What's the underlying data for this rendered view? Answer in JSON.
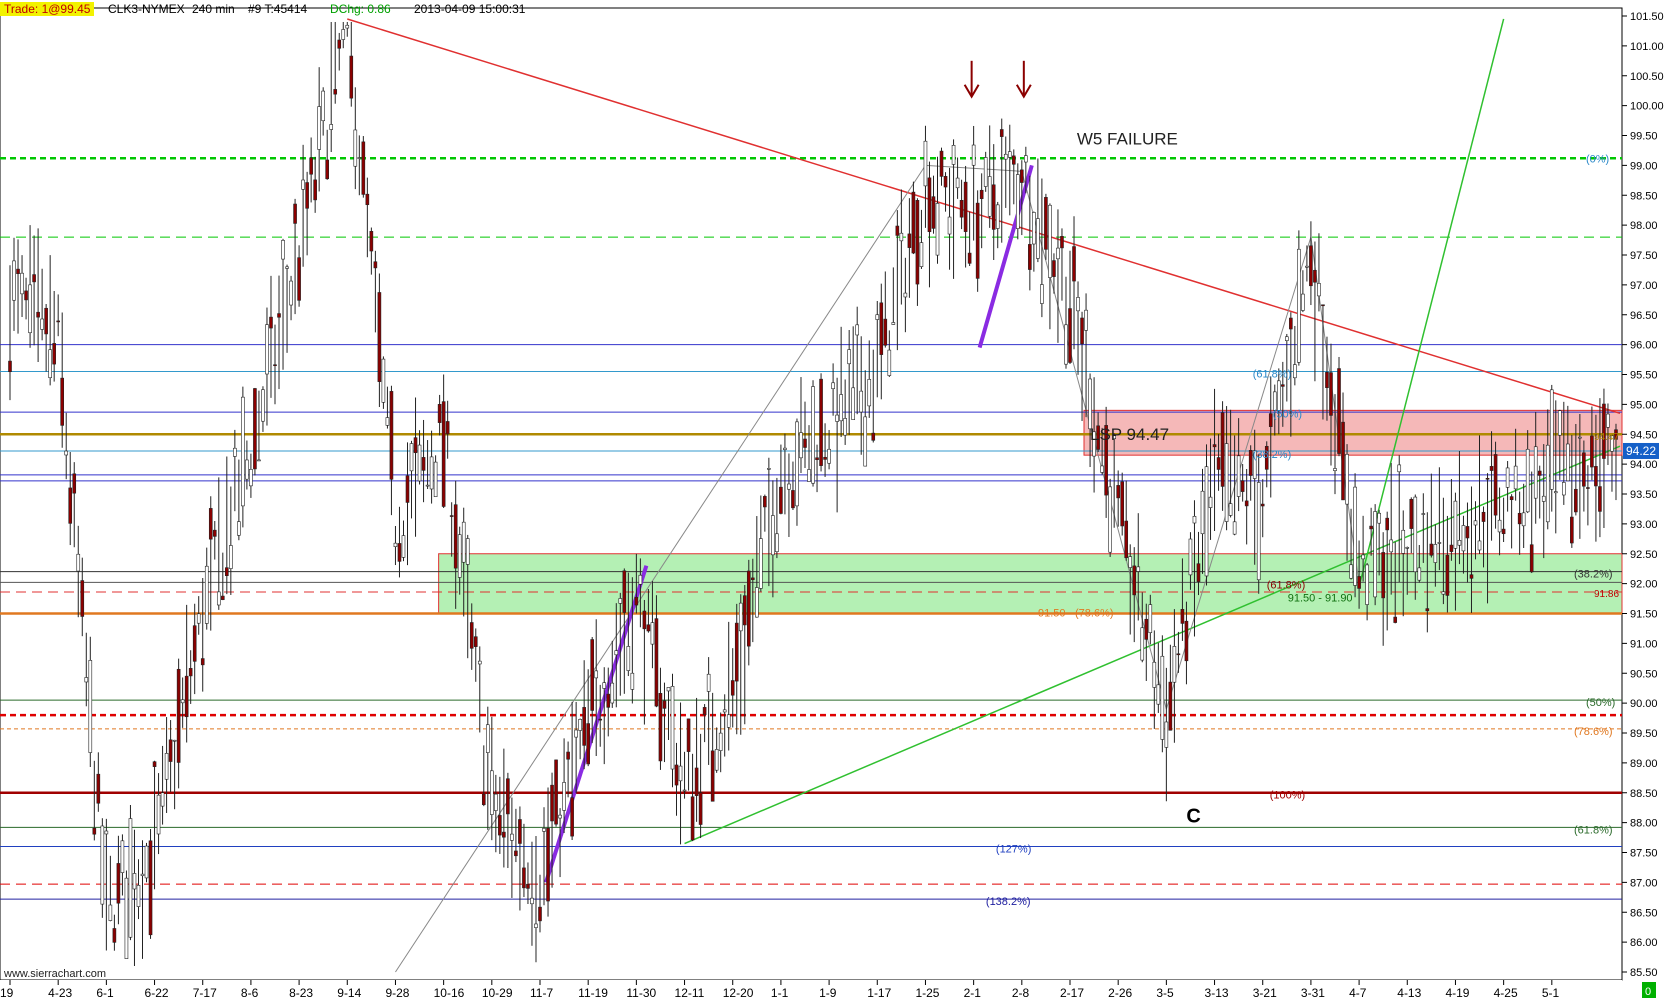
{
  "header": {
    "trade": "Trade: 1@99.45",
    "symbol": "CLK3-NYMEX",
    "interval": "240 min",
    "bar_info": "#9 T:45414",
    "dchg": "DChg: 0.86",
    "datetime": "2013-04-09 15:00:31",
    "trade_bg": "#f2f200",
    "dchg_color": "#00a000"
  },
  "footer": {
    "url": "www.sierrachart.com"
  },
  "chart_data": {
    "type": "candlestick",
    "title": "",
    "price_axis": {
      "min": 85.5,
      "max": 101.5,
      "tick_step": 0.5,
      "current_price": "94.22",
      "bottom_right_label": "0"
    },
    "date_axis": {
      "ticks": [
        "19",
        "4-23",
        "6-1",
        "6-22",
        "7-17",
        "8-6",
        "8-23",
        "9-14",
        "9-28",
        "10-16",
        "10-29",
        "11-7",
        "11-19",
        "11-30",
        "12-11",
        "12-20",
        "1-1",
        "1-9",
        "1-17",
        "1-25",
        "2-1",
        "2-8",
        "2-17",
        "2-26",
        "3-5",
        "3-13",
        "3-21",
        "3-31",
        "4-7",
        "4-13",
        "4-19",
        "4-25",
        "5-1"
      ]
    },
    "annotations": {
      "w5_failure": "W5 FAILURE",
      "lsp": "LSP  94.47",
      "wave_c": "C",
      "zone_label": "91.50 - 91.90",
      "zone_left_value": "91.50",
      "zone_left_fib": "(78.6%)",
      "fib_0": "(0%)",
      "fib_61_8_top": "(61.8%)",
      "fib_50_top": "(50%)",
      "fib_38_2_top": "(38.2%)",
      "fib_38_2_right": "(38.2%)",
      "fib_61_8_mid": "(61.8%)",
      "fib_50_right": "(50%)",
      "fib_78_6_right": "(78.6%)",
      "fib_100": "(100%)",
      "fib_61_8_low": "(61.8%)",
      "fib_127": "(127%)",
      "fib_138_2": "(138.2%)",
      "lsp_axis_label": "94.47",
      "red_dash_label": "91.86"
    },
    "horizontal_levels": [
      {
        "price": 99.12,
        "color": "#00c800",
        "style": "dash-bold"
      },
      {
        "price": 97.8,
        "color": "#00c800",
        "style": "dash"
      },
      {
        "price": 96.0,
        "color": "#3333cc",
        "style": "solid"
      },
      {
        "price": 95.55,
        "color": "#3399cc",
        "style": "solid-thin"
      },
      {
        "price": 94.87,
        "color": "#3333cc",
        "style": "solid-thin"
      },
      {
        "price": 94.5,
        "color": "#b08a00",
        "style": "solid-bold"
      },
      {
        "price": 94.22,
        "color": "#3399cc",
        "style": "solid-thin"
      },
      {
        "price": 93.82,
        "color": "#3333cc",
        "style": "solid"
      },
      {
        "price": 93.72,
        "color": "#3333cc",
        "style": "solid"
      },
      {
        "price": 92.2,
        "color": "#333333",
        "style": "solid-thin"
      },
      {
        "price": 92.02,
        "color": "#555555",
        "style": "solid-thin"
      },
      {
        "price": 91.86,
        "color": "#e03030",
        "style": "dash"
      },
      {
        "price": 91.5,
        "color": "#e07820",
        "style": "solid-bold"
      },
      {
        "price": 90.05,
        "color": "#2a6a2a",
        "style": "solid-thin"
      },
      {
        "price": 89.8,
        "color": "#e00000",
        "style": "dash-bold"
      },
      {
        "price": 89.57,
        "color": "#e07820",
        "style": "dash-fine"
      },
      {
        "price": 88.5,
        "color": "#a00000",
        "style": "solid-bold"
      },
      {
        "price": 87.92,
        "color": "#2a6a2a",
        "style": "solid-thin"
      },
      {
        "price": 87.6,
        "color": "#2040c0",
        "style": "solid"
      },
      {
        "price": 86.97,
        "color": "#e00000",
        "style": "dash"
      },
      {
        "price": 86.72,
        "color": "#2020a0",
        "style": "solid-thin"
      }
    ],
    "zones": [
      {
        "from": 91.5,
        "to": 92.5,
        "fill": "#b4f0b4",
        "border": "#e03030"
      },
      {
        "from": 94.15,
        "to": 94.9,
        "fill": "#f5b8b8",
        "border": "#e03030"
      }
    ],
    "trendlines": [
      {
        "name": "red-downtrend",
        "from_date": "9-14",
        "from_price": 101.45,
        "to_date": "end",
        "to_price": 94.85,
        "color": "#e03030"
      },
      {
        "name": "green-uptrend",
        "from_date": "12-11",
        "from_price": 87.65,
        "to_date": "end",
        "to_price": 94.3,
        "color": "#30c030"
      },
      {
        "name": "green-projection",
        "from_date": "4-7",
        "from_price": 91.95,
        "to_date": "4-25",
        "to_price": 101.45,
        "color": "#30c030"
      }
    ],
    "series": [
      {
        "type": "close-path",
        "points": [
          [
            "19",
            96.8
          ],
          [
            "4-23",
            96.0
          ],
          [
            "6-1",
            86.5
          ],
          [
            "6-22",
            87.5
          ],
          [
            "7-17",
            91.5
          ],
          [
            "8-6",
            94.2
          ],
          [
            "8-23",
            97.5
          ],
          [
            "9-14",
            101.4
          ],
          [
            "9-28",
            93.0
          ],
          [
            "10-16",
            94.5
          ],
          [
            "10-29",
            88.3
          ],
          [
            "11-7",
            87.1
          ],
          [
            "11-19",
            89.6
          ],
          [
            "11-30",
            91.8
          ],
          [
            "12-11",
            88.6
          ],
          [
            "12-20",
            90.2
          ],
          [
            "1-1",
            93.9
          ],
          [
            "1-9",
            94.6
          ],
          [
            "1-17",
            95.6
          ],
          [
            "1-25",
            98.6
          ],
          [
            "2-1",
            98.2
          ],
          [
            "2-8",
            98.8
          ],
          [
            "2-17",
            96.8
          ],
          [
            "2-26",
            93.0
          ],
          [
            "3-5",
            89.9
          ],
          [
            "3-13",
            93.7
          ],
          [
            "3-21",
            93.4
          ],
          [
            "3-31",
            97.6
          ],
          [
            "4-7",
            92.2
          ],
          [
            "end",
            94.22
          ]
        ]
      }
    ]
  }
}
